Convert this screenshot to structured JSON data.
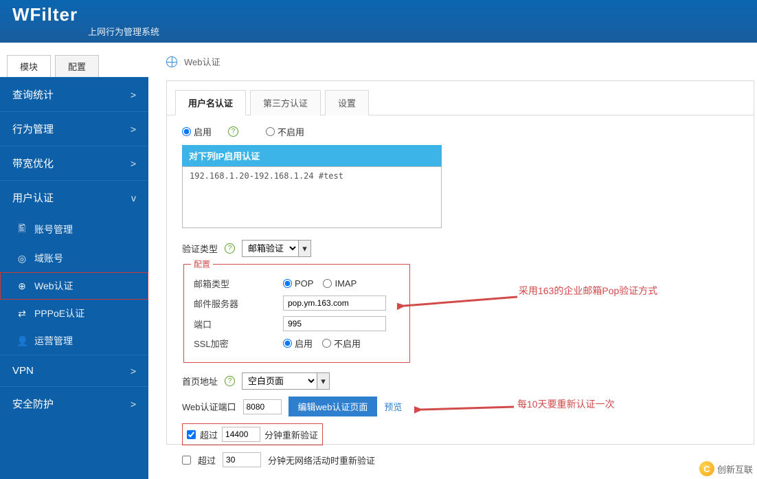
{
  "header": {
    "logo": "WFilter",
    "subtitle": "上网行为管理系统"
  },
  "sidebar_tabs": {
    "module": "模块",
    "config": "配置"
  },
  "sidebar": {
    "items": [
      {
        "label": "查询统计",
        "chev": ">"
      },
      {
        "label": "行为管理",
        "chev": ">"
      },
      {
        "label": "带宽优化",
        "chev": ">"
      },
      {
        "label": "用户认证",
        "chev": "v"
      },
      {
        "label": "VPN",
        "chev": ">"
      },
      {
        "label": "安全防护",
        "chev": ">"
      }
    ],
    "sub": [
      {
        "icon": "id-card-icon",
        "glyph": "🖺",
        "label": "账号管理"
      },
      {
        "icon": "domain-icon",
        "glyph": "◎",
        "label": "域账号"
      },
      {
        "icon": "globe-icon",
        "glyph": "⊕",
        "label": "Web认证"
      },
      {
        "icon": "ppp-icon",
        "glyph": "⇄",
        "label": "PPPoE认证"
      },
      {
        "icon": "user-icon",
        "glyph": "👤",
        "label": "运营管理"
      }
    ]
  },
  "crumb": {
    "title": "Web认证"
  },
  "tabs": {
    "user": "用户名认证",
    "third": "第三方认证",
    "settings": "设置"
  },
  "form": {
    "enable": "启用",
    "disable": "不启用",
    "ip_header": "对下列IP启用认证",
    "ip_value": "192.168.1.20-192.168.1.24 #test",
    "verify_type_label": "验证类型",
    "verify_type_value": "邮箱验证",
    "config_legend": "配置",
    "mail_type_label": "邮箱类型",
    "pop": "POP",
    "imap": "IMAP",
    "mail_server_label": "邮件服务器",
    "mail_server_value": "pop.ym.163.com",
    "port_label": "端口",
    "port_value": "995",
    "ssl_label": "SSL加密",
    "homepage_label": "首页地址",
    "homepage_value": "空白页面",
    "webport_label": "Web认证端口",
    "webport_value": "8080",
    "edit_btn": "编辑web认证页面",
    "preview": "预览",
    "exceed": "超过",
    "minutes_reverify": "分钟重新验证",
    "timeout_value": "14400",
    "idle_value": "30",
    "idle_label": "分钟无网络活动时重新验证"
  },
  "annotations": {
    "a1": "采用163的企业邮箱Pop验证方式",
    "a2": "每10天要重新认证一次"
  },
  "brand": "创新互联"
}
